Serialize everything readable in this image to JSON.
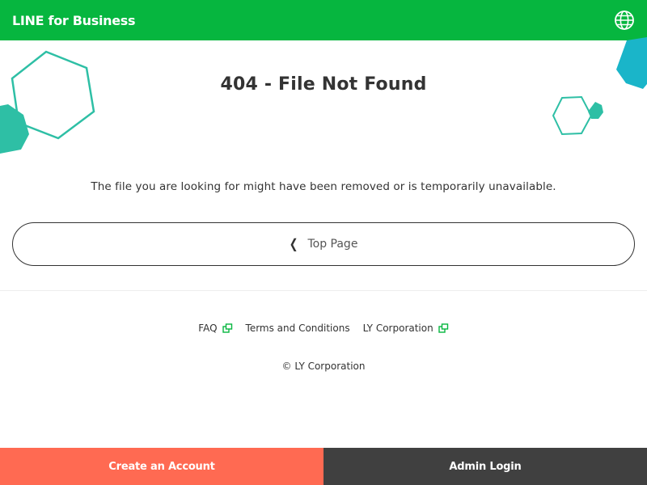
{
  "header": {
    "brand": "LINE for Business",
    "language_icon": "globe-icon"
  },
  "main": {
    "title": "404 - File Not Found",
    "message": "The file you are looking for might have been removed or is temporarily unavailable.",
    "top_page_button": {
      "label": "Top Page",
      "icon": "chevron-left-icon"
    }
  },
  "footer": {
    "links": [
      {
        "label": "FAQ",
        "external": true
      },
      {
        "label": "Terms and Conditions",
        "external": false
      },
      {
        "label": "LY Corporation",
        "external": true
      }
    ],
    "copyright": "© LY Corporation"
  },
  "bottom_bar": {
    "create_account": "Create an Account",
    "admin_login": "Admin Login"
  },
  "colors": {
    "brand_green": "#06b63f",
    "hexagon_teal": "#2ebfa5",
    "hexagon_blue": "#1ab5c9",
    "create_account_bg": "#ff6a52",
    "admin_login_bg": "#404040"
  }
}
